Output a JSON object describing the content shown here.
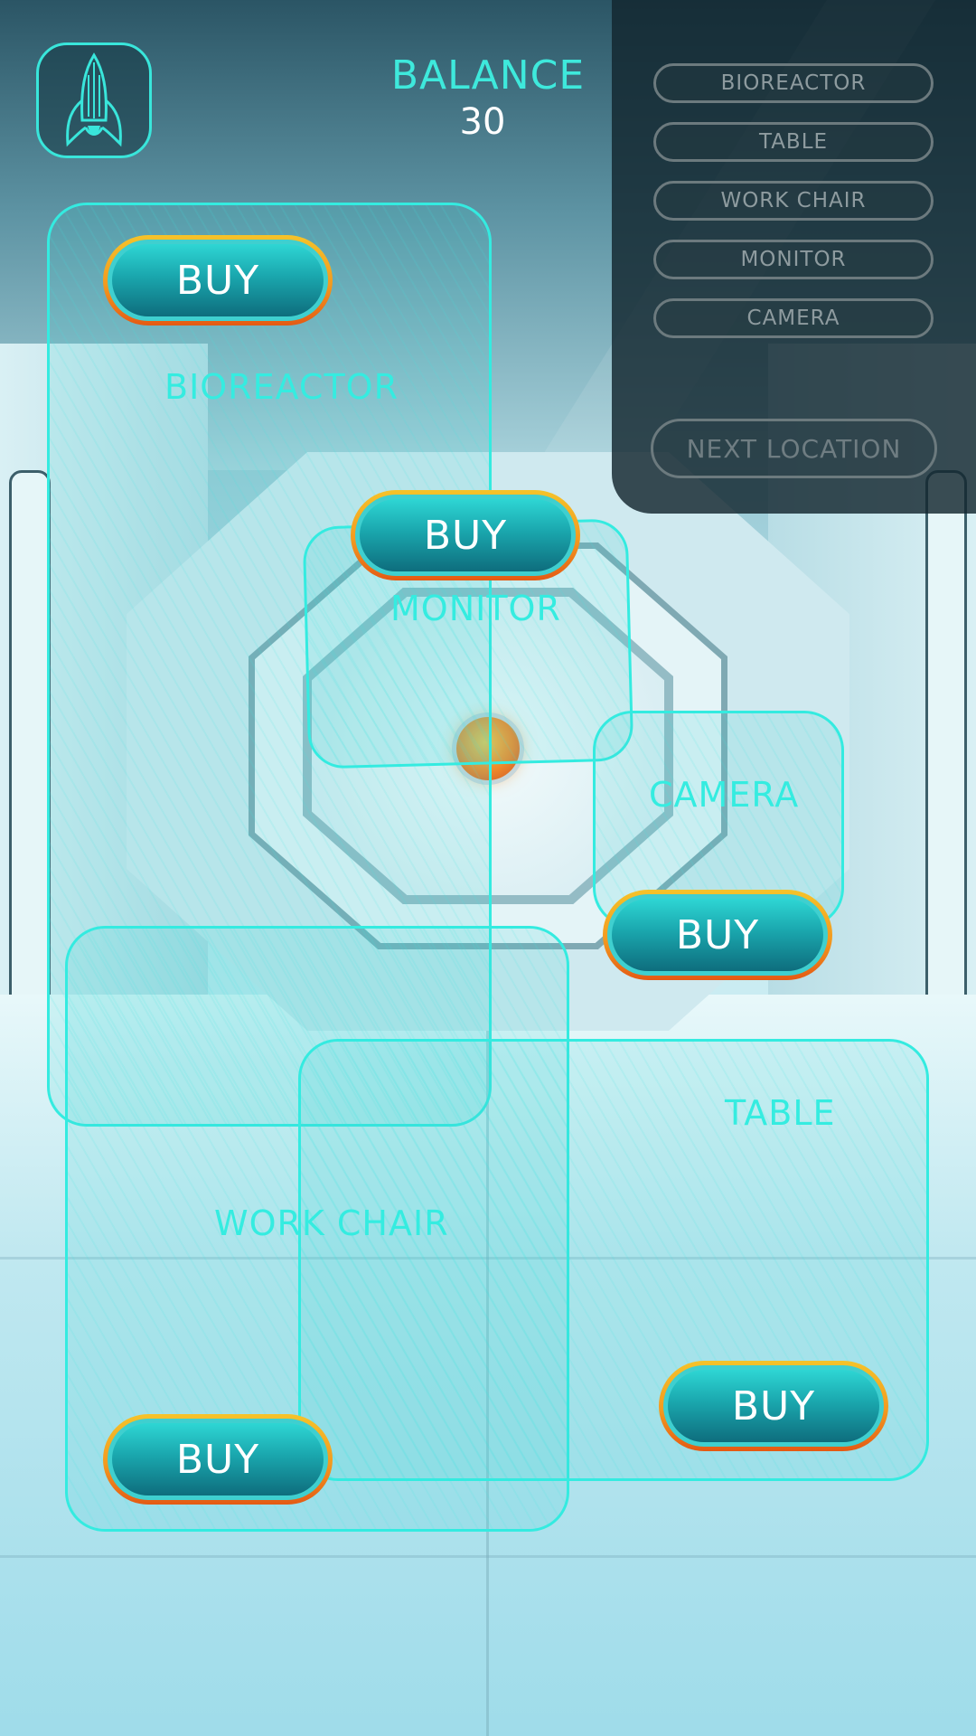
{
  "balance": {
    "label": "BALANCE",
    "value": "30"
  },
  "icons": {
    "ship": "rocket-ship-icon"
  },
  "colors": {
    "accent": "#34ebe0",
    "buy_border_top": "#f5c32a",
    "buy_border_bottom": "#e45a14",
    "buy_fill": "#1aa6ad",
    "menu_bg": "#12262e",
    "menu_text": "#8e9b9f"
  },
  "menu": {
    "items": [
      "BIOREACTOR",
      "TABLE",
      "WORK CHAIR",
      "MONITOR",
      "CAMERA"
    ],
    "next_location": "NEXT LOCATION"
  },
  "zones": {
    "bioreactor": {
      "label": "BIOREACTOR",
      "buy": "BUY"
    },
    "monitor": {
      "label": "MONITOR",
      "buy": "BUY"
    },
    "camera": {
      "label": "CAMERA",
      "buy": "BUY"
    },
    "work_chair": {
      "label": "WORK CHAIR",
      "buy": "BUY"
    },
    "table": {
      "label": "TABLE",
      "buy": "BUY"
    }
  }
}
